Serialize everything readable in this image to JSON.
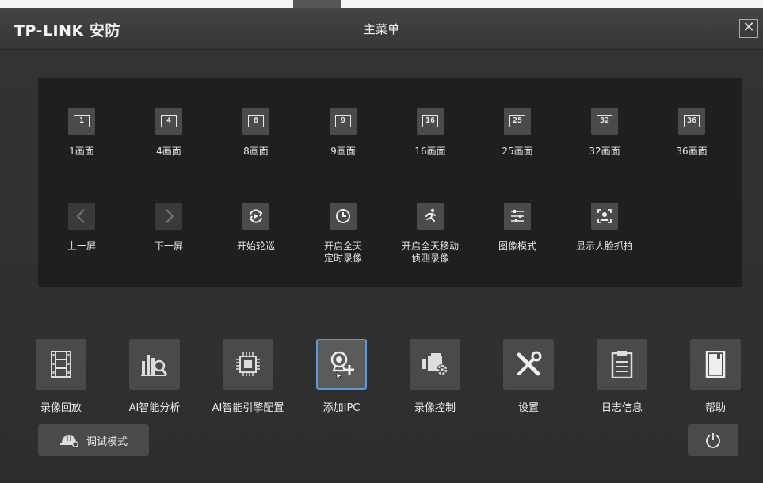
{
  "header": {
    "logo": "TP-LINK 安防",
    "title": "主菜单",
    "close": "✕"
  },
  "layout_options": [
    {
      "label": "1画面",
      "number": "1",
      "icon": "split-1-icon"
    },
    {
      "label": "4画面",
      "number": "4",
      "icon": "split-4-icon"
    },
    {
      "label": "8画面",
      "number": "8",
      "icon": "split-8-icon"
    },
    {
      "label": "9画面",
      "number": "9",
      "icon": "split-9-icon"
    },
    {
      "label": "16画面",
      "number": "16",
      "icon": "split-16-icon"
    },
    {
      "label": "25画面",
      "number": "25",
      "icon": "split-25-icon"
    },
    {
      "label": "32画面",
      "number": "32",
      "icon": "split-32-icon"
    },
    {
      "label": "36画面",
      "number": "36",
      "icon": "split-36-icon"
    }
  ],
  "actions": [
    {
      "line1": "上一屏",
      "line2": "",
      "icon": "chevron-left-icon"
    },
    {
      "line1": "下一屏",
      "line2": "",
      "icon": "chevron-right-icon"
    },
    {
      "line1": "开始轮巡",
      "line2": "",
      "icon": "patrol-icon"
    },
    {
      "line1": "开启全天",
      "line2": "定时录像",
      "icon": "clock-icon"
    },
    {
      "line1": "开启全天移动",
      "line2": "侦测录像",
      "icon": "motion-icon"
    },
    {
      "line1": "图像模式",
      "line2": "",
      "icon": "sliders-icon"
    },
    {
      "line1": "显示人脸抓拍",
      "line2": "",
      "icon": "face-icon"
    }
  ],
  "functions": [
    {
      "label": "录像回放",
      "icon": "film-icon"
    },
    {
      "label": "AI智能分析",
      "icon": "chart-search-icon"
    },
    {
      "label": "AI智能引擎配置",
      "icon": "chip-icon"
    },
    {
      "label": "添加IPC",
      "icon": "add-camera-icon"
    },
    {
      "label": "录像控制",
      "icon": "camera-gear-icon"
    },
    {
      "label": "设置",
      "icon": "tools-icon"
    },
    {
      "label": "日志信息",
      "icon": "clipboard-icon"
    },
    {
      "label": "帮助",
      "icon": "book-icon"
    }
  ],
  "footer": {
    "debug_label": "调试模式"
  }
}
